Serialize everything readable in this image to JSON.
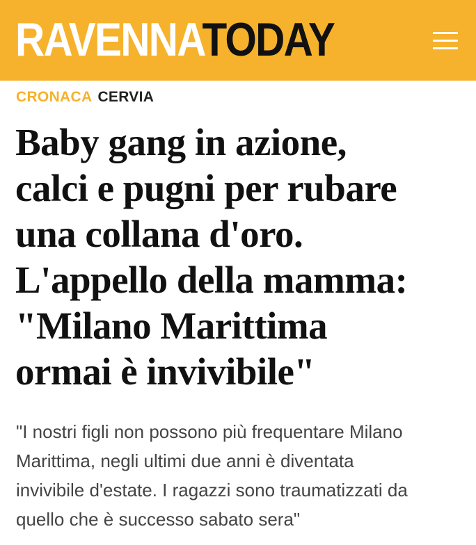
{
  "header": {
    "logo_part_a": "RAVENNA",
    "logo_part_b": "TODAY",
    "menu_icon": "hamburger-menu-icon",
    "background_color": "#f6b22c"
  },
  "breadcrumb": {
    "section": "CRONACA",
    "location": "CERVIA",
    "section_color": "#f6b22c"
  },
  "article": {
    "headline_lines": [
      "Baby gang in azione,",
      "calci e pugni per rubare",
      "una collana d'oro.",
      "L'appello della mamma:",
      "\"Milano Marittima",
      "ormai è invivibile\""
    ],
    "subtitle_lines": [
      "\"I nostri figli non possono più frequentare Milano",
      "Marittima, negli ultimi due anni è diventata",
      "invivibile d'estate. I ragazzi sono traumatizzati da",
      "quello che è successo sabato sera\""
    ]
  }
}
